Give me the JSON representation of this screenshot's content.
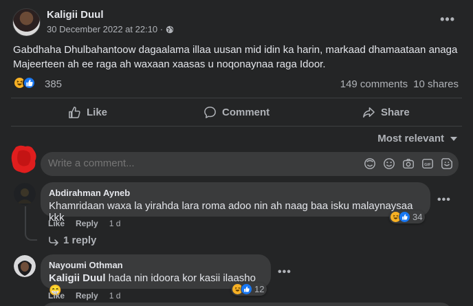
{
  "post": {
    "author": "Kaligii Duul",
    "date": "30 December 2022 at 22:10 ·",
    "text": "Gabdhaha Dhulbahantoow dagaalama illaa uusan mid idin ka harin, markaad dhamaataan anaga Majeerteen ah ee raga ah waxaan xaasas u noqonaynaa raga Idoor.",
    "reaction_count": "385",
    "comments": "149 comments",
    "shares": "10 shares"
  },
  "actions": {
    "like": "Like",
    "comment": "Comment",
    "share": "Share"
  },
  "sort": {
    "label": "Most relevant"
  },
  "write": {
    "placeholder": "Write a comment..."
  },
  "comments": [
    {
      "name": "Abdirahman Ayneb",
      "text": "Khamridaan waxa la yirahda lara roma adoo nin ah naag baa isku malaynaysaa kkk",
      "like": "Like",
      "reply": "Reply",
      "time": "1 d",
      "reactions": "34",
      "replies": "1 reply"
    },
    {
      "name": "Nayoumi Othman",
      "mention": "Kaligii Duul",
      "text": "hada nin idoora kor kasii ilaasho😁",
      "like": "Like",
      "reply": "Reply",
      "time": "1 d",
      "reactions": "12"
    }
  ],
  "colors": {
    "background": "#242526",
    "bubble": "#3a3b3c",
    "text": "#e4e6eb",
    "muted": "#b0b3b8",
    "like_blue": "#1877f2",
    "haha_yellow": "#f7b125"
  }
}
